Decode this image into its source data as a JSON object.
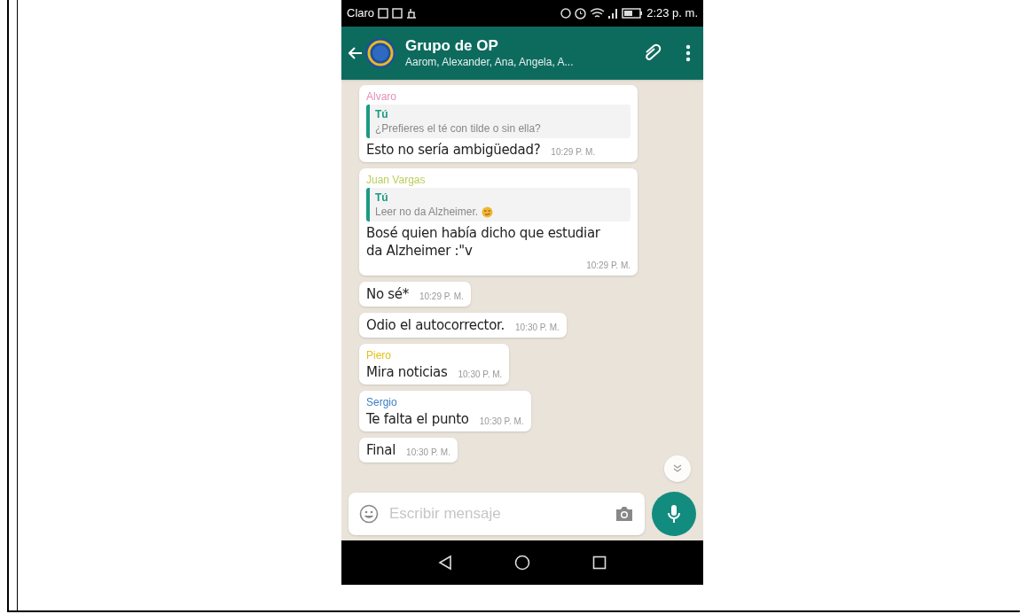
{
  "status_bar": {
    "carrier": "Claro",
    "time": "2:23 p. m."
  },
  "header": {
    "title": "Grupo de OP",
    "subtitle": "Aarom, Alexander, Ana, Angela, A..."
  },
  "messages": [
    {
      "kind": "reply",
      "sender": "Alvaro",
      "color": "#e58fb8",
      "quote_author": "Tú",
      "quote_text": "¿Prefieres el té con tilde o sin ella?",
      "quote_emoji": false,
      "text": "Esto no sería ambigüedad?",
      "time": "10:29 P. M."
    },
    {
      "kind": "reply",
      "sender": "Juan Vargas",
      "color": "#b9cf5a",
      "quote_author": "Tú",
      "quote_text": "Leer no da Alzheimer.",
      "quote_emoji": true,
      "text": "Bosé quien había dicho que estudiar da Alzheimer :\"v",
      "time": "10:29 P. M."
    },
    {
      "kind": "plain",
      "text": "No sé*",
      "time": "10:29 P. M."
    },
    {
      "kind": "plain",
      "text": "Odio el autocorrector.",
      "time": "10:30 P. M."
    },
    {
      "kind": "named",
      "sender": "Piero",
      "color": "#e0c21a",
      "text": "Mira noticias",
      "time": "10:30 P. M."
    },
    {
      "kind": "named",
      "sender": "Sergio",
      "color": "#3b7fc4",
      "text": "Te falta el punto",
      "time": "10:30 P. M."
    },
    {
      "kind": "plain",
      "text": "Final",
      "time": "10:30 P. M."
    }
  ],
  "composer": {
    "placeholder": "Escribir mensaje"
  }
}
